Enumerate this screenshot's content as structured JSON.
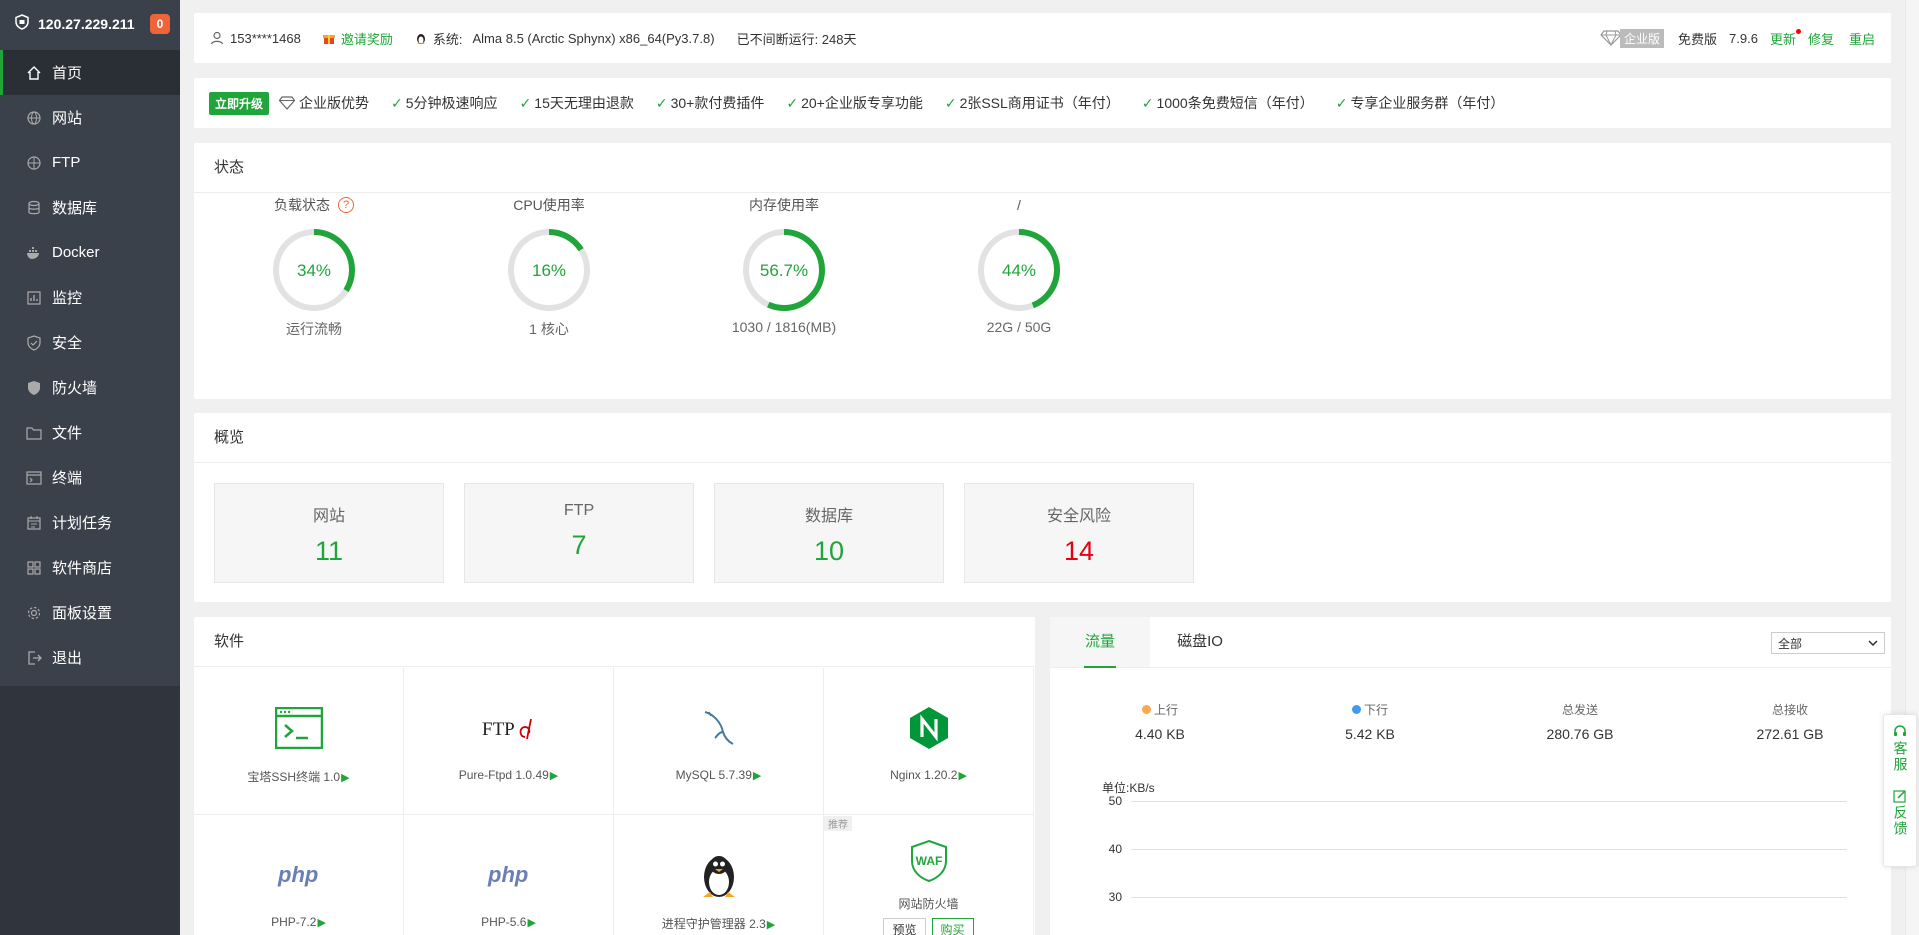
{
  "sidebar": {
    "ip": "120.27.229.211",
    "badge": "0",
    "items": [
      {
        "label": "首页",
        "icon": "home-icon"
      },
      {
        "label": "网站",
        "icon": "globe-icon"
      },
      {
        "label": "FTP",
        "icon": "ftp-icon"
      },
      {
        "label": "数据库",
        "icon": "database-icon"
      },
      {
        "label": "Docker",
        "icon": "docker-icon"
      },
      {
        "label": "监控",
        "icon": "monitor-icon"
      },
      {
        "label": "安全",
        "icon": "shield-check-icon"
      },
      {
        "label": "防火墙",
        "icon": "firewall-icon"
      },
      {
        "label": "文件",
        "icon": "folder-icon"
      },
      {
        "label": "终端",
        "icon": "terminal-icon"
      },
      {
        "label": "计划任务",
        "icon": "calendar-icon"
      },
      {
        "label": "软件商店",
        "icon": "grid-icon"
      },
      {
        "label": "面板设置",
        "icon": "gear-icon"
      },
      {
        "label": "退出",
        "icon": "logout-icon"
      }
    ]
  },
  "topbar": {
    "user": "153****1468",
    "invite": "邀请奖励",
    "system_label": "系统:",
    "system_value": "Alma 8.5 (Arctic Sphynx) x86_64(Py3.7.8)",
    "uptime": "已不间断运行: 248天",
    "enterprise": "企业版",
    "edition": "免费版",
    "version": "7.9.6",
    "update": "更新",
    "repair": "修复",
    "restart": "重启"
  },
  "features": {
    "upgrade": "立即升级",
    "title": "企业版优势",
    "items": [
      "5分钟极速响应",
      "15天无理由退款",
      "30+款付费插件",
      "20+企业版专享功能",
      "2张SSL商用证书（年付）",
      "1000条免费短信（年付）",
      "专享企业服务群（年付）"
    ]
  },
  "status": {
    "title": "状态",
    "gauges": [
      {
        "label": "负载状态",
        "value": "34%",
        "percent": 34,
        "sub": "运行流畅"
      },
      {
        "label": "CPU使用率",
        "value": "16%",
        "percent": 16,
        "sub": "1 核心"
      },
      {
        "label": "内存使用率",
        "value": "56.7%",
        "percent": 56.7,
        "sub": "1030 / 1816(MB)"
      },
      {
        "label": "/",
        "value": "44%",
        "percent": 44,
        "sub": "22G / 50G"
      }
    ],
    "colors": {
      "ring_fg": "#20a53a",
      "ring_bg": "#e2e2e2"
    }
  },
  "overview": {
    "title": "概览",
    "boxes": [
      {
        "label": "网站",
        "value": "11"
      },
      {
        "label": "FTP",
        "value": "7"
      },
      {
        "label": "数据库",
        "value": "10"
      },
      {
        "label": "安全风险",
        "value": "14"
      }
    ]
  },
  "software": {
    "title": "软件",
    "items": [
      {
        "name": "宝塔SSH终端 1.0",
        "icon": "ssh-terminal-icon"
      },
      {
        "name": "Pure-Ftpd 1.0.49",
        "icon": "ftpd-logo-icon"
      },
      {
        "name": "MySQL 5.7.39",
        "icon": "mysql-dolphin-icon"
      },
      {
        "name": "Nginx 1.20.2",
        "icon": "nginx-logo-icon"
      },
      {
        "name": "PHP-7.2",
        "icon": "php-logo-icon"
      },
      {
        "name": "PHP-5.6",
        "icon": "php-logo-icon"
      },
      {
        "name": "进程守护管理器 2.3",
        "icon": "penguin-icon"
      },
      {
        "name": "网站防火墙",
        "icon": "waf-shield-icon",
        "tag": "推荐",
        "preview": "预览",
        "buy": "购买"
      }
    ],
    "php_text": "php",
    "ftp_text": "FTP",
    "waf_text": "WAF"
  },
  "traffic": {
    "tabs": [
      "流量",
      "磁盘IO"
    ],
    "select": "全部",
    "stats": [
      {
        "label": "上行",
        "value": "4.40 KB",
        "dot": "#f7a94b"
      },
      {
        "label": "下行",
        "value": "5.42 KB",
        "dot": "#3e9bf0"
      },
      {
        "label": "总发送",
        "value": "280.76 GB"
      },
      {
        "label": "总接收",
        "value": "272.61 GB"
      }
    ],
    "unit": "单位:KB/s",
    "y_ticks": [
      "50",
      "40",
      "30"
    ]
  },
  "float_panel": {
    "service": "客服",
    "feedback": "反馈"
  }
}
